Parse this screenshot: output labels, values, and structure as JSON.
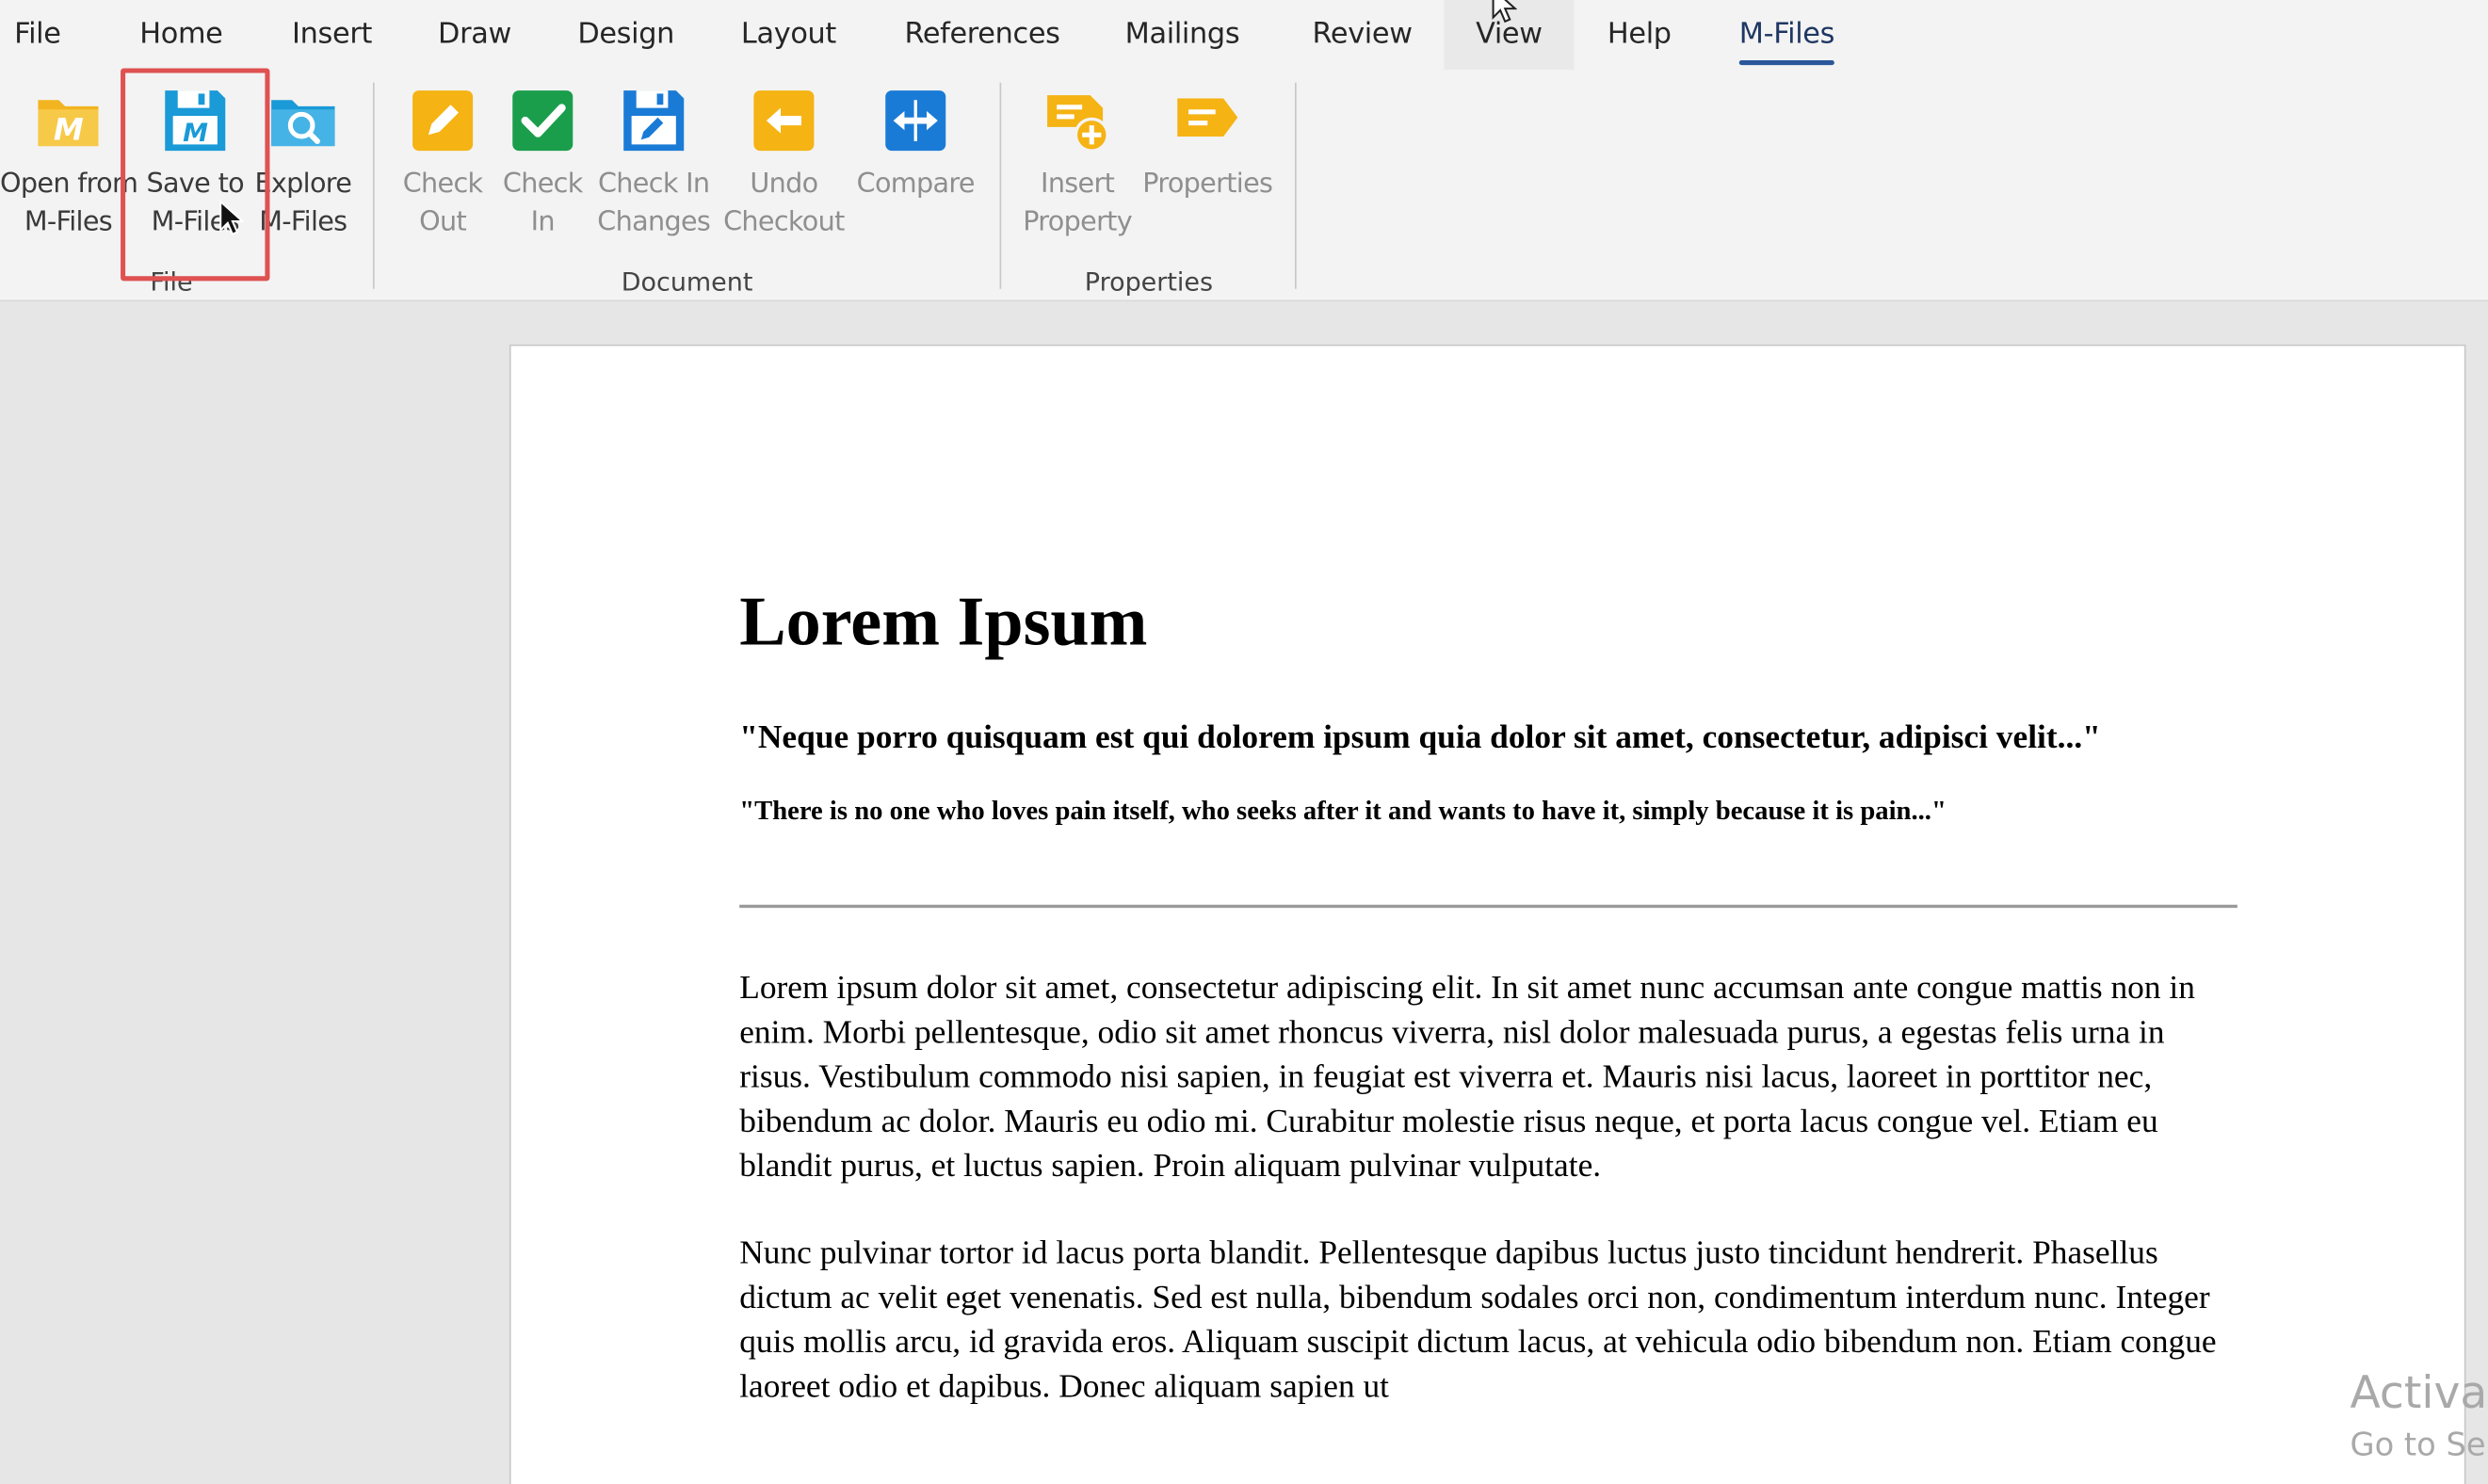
{
  "ribbon": {
    "tabs": [
      {
        "id": "file",
        "label": "File"
      },
      {
        "id": "home",
        "label": "Home"
      },
      {
        "id": "insert",
        "label": "Insert"
      },
      {
        "id": "draw",
        "label": "Draw"
      },
      {
        "id": "design",
        "label": "Design"
      },
      {
        "id": "layout",
        "label": "Layout"
      },
      {
        "id": "references",
        "label": "References"
      },
      {
        "id": "mailings",
        "label": "Mailings"
      },
      {
        "id": "review",
        "label": "Review"
      },
      {
        "id": "view",
        "label": "View"
      },
      {
        "id": "help",
        "label": "Help"
      },
      {
        "id": "mfiles",
        "label": "M-Files"
      }
    ],
    "active_tab": "M-Files",
    "groups": {
      "file": {
        "label": "File",
        "buttons": {
          "open": {
            "line1": "Open from",
            "line2": "M-Files",
            "icon": "folder-m-icon"
          },
          "save": {
            "line1": "Save to",
            "line2": "M-Files",
            "icon": "save-m-icon"
          },
          "explore": {
            "line1": "Explore",
            "line2": "M-Files",
            "icon": "explore-magnifier-icon"
          }
        }
      },
      "document": {
        "label": "Document",
        "buttons": {
          "checkout": {
            "line1": "Check",
            "line2": "Out",
            "icon": "pencil-icon"
          },
          "checkin": {
            "line1": "Check",
            "line2": "In",
            "icon": "checkmark-icon"
          },
          "checkin_changes": {
            "line1": "Check In",
            "line2": "Changes",
            "icon": "save-pencil-icon"
          },
          "undo_checkout": {
            "line1": "Undo",
            "line2": "Checkout",
            "icon": "undo-arrow-icon"
          },
          "compare": {
            "line1": "Compare",
            "line2": "",
            "icon": "compare-icon"
          }
        }
      },
      "properties": {
        "label": "Properties",
        "buttons": {
          "insert_property": {
            "line1": "Insert",
            "line2": "Property",
            "icon": "insert-property-icon"
          },
          "properties": {
            "line1": "Properties",
            "line2": "",
            "icon": "properties-icon"
          }
        }
      }
    }
  },
  "colors": {
    "accent_blue": "#1a9ad6",
    "folder_yellow": "#f2b420",
    "check_green": "#1a9e4b",
    "highlight_red": "#e05151"
  },
  "document": {
    "title": "Lorem Ipsum",
    "quote_latin": "\"Neque porro quisquam est qui dolorem ipsum quia dolor sit amet, consectetur, adipisci velit...\"",
    "quote_english": "\"There is no one who loves pain itself, who seeks after it and wants to have it, simply because it is pain...\"",
    "paragraph1": "Lorem ipsum dolor sit amet, consectetur adipiscing elit. In sit amet nunc accumsan ante congue mattis non in enim. Morbi pellentesque, odio sit amet rhoncus viverra, nisl dolor malesuada purus, a egestas felis urna in risus. Vestibulum commodo nisi sapien, in feugiat est viverra et. Mauris nisi lacus, laoreet in porttitor nec, bibendum ac dolor. Mauris eu odio mi. Curabitur molestie risus neque, et porta lacus congue vel. Etiam eu blandit purus, et luctus sapien. Proin aliquam pulvinar vulputate.",
    "paragraph2": "Nunc pulvinar tortor id lacus porta blandit. Pellentesque dapibus luctus justo tincidunt hendrerit. Phasellus dictum ac velit eget venenatis. Sed est nulla, bibendum sodales orci non, condimentum interdum nunc. Integer quis mollis arcu, id gravida eros. Aliquam suscipit dictum lacus, at vehicula odio bibendum non. Etiam congue laoreet odio et dapibus. Donec aliquam sapien ut"
  },
  "watermark": {
    "line1": "Activat",
    "line2": "Go to Se"
  }
}
